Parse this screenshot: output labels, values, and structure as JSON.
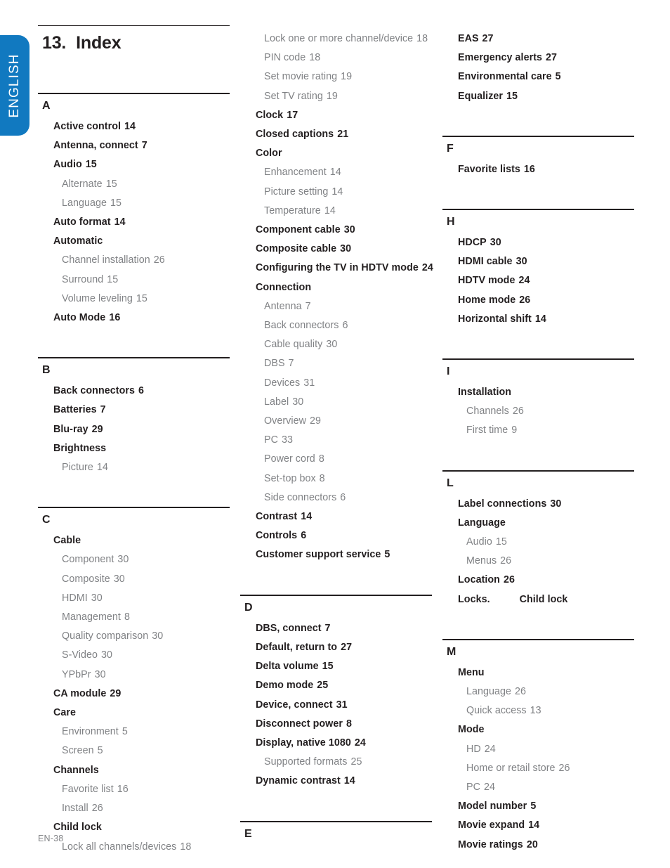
{
  "language_tab": {
    "label": "ENGLISH"
  },
  "title": {
    "number": "13.",
    "text": "Index"
  },
  "footer": {
    "page_label": "EN-38"
  },
  "colors": {
    "tab_blue": "#1179c0",
    "text_dark": "#231f20",
    "text_light": "#808285"
  },
  "columns": [
    {
      "id": "column-1",
      "has_title": true,
      "sections": [
        {
          "letter": "A",
          "entries": [
            {
              "level": 1,
              "text": "Active control",
              "page": "14"
            },
            {
              "level": 1,
              "text": "Antenna, connect",
              "page": "7"
            },
            {
              "level": 1,
              "text": "Audio",
              "page": "15"
            },
            {
              "level": 2,
              "text": "Alternate",
              "page": "15"
            },
            {
              "level": 2,
              "text": "Language",
              "page": "15"
            },
            {
              "level": 1,
              "text": "Auto format",
              "page": "14"
            },
            {
              "level": 1,
              "text": "Automatic",
              "page": ""
            },
            {
              "level": 2,
              "text": "Channel installation",
              "page": "26"
            },
            {
              "level": 2,
              "text": "Surround",
              "page": "15"
            },
            {
              "level": 2,
              "text": "Volume leveling",
              "page": "15"
            },
            {
              "level": 1,
              "text": "Auto Mode",
              "page": "16"
            }
          ]
        },
        {
          "letter": "B",
          "entries": [
            {
              "level": 1,
              "text": "Back connectors",
              "page": "6"
            },
            {
              "level": 1,
              "text": "Batteries",
              "page": "7"
            },
            {
              "level": 1,
              "text": "Blu-ray",
              "page": "29"
            },
            {
              "level": 1,
              "text": "Brightness",
              "page": ""
            },
            {
              "level": 2,
              "text": "Picture",
              "page": "14"
            }
          ]
        },
        {
          "letter": "C",
          "entries": [
            {
              "level": 1,
              "text": "Cable",
              "page": ""
            },
            {
              "level": 2,
              "text": "Component",
              "page": "30"
            },
            {
              "level": 2,
              "text": "Composite",
              "page": "30"
            },
            {
              "level": 2,
              "text": "HDMI",
              "page": "30"
            },
            {
              "level": 2,
              "text": "Management",
              "page": "8"
            },
            {
              "level": 2,
              "text": "Quality comparison",
              "page": "30"
            },
            {
              "level": 2,
              "text": "S-Video",
              "page": "30"
            },
            {
              "level": 2,
              "text": "YPbPr",
              "page": "30"
            },
            {
              "level": 1,
              "text": "CA module",
              "page": "29"
            },
            {
              "level": 1,
              "text": "Care",
              "page": ""
            },
            {
              "level": 2,
              "text": "Environment",
              "page": "5"
            },
            {
              "level": 2,
              "text": "Screen",
              "page": "5"
            },
            {
              "level": 1,
              "text": "Channels",
              "page": ""
            },
            {
              "level": 2,
              "text": "Favorite list",
              "page": "16"
            },
            {
              "level": 2,
              "text": "Install",
              "page": "26"
            },
            {
              "level": 1,
              "text": "Child lock",
              "page": ""
            },
            {
              "level": 2,
              "text": "Lock all channels/devices",
              "page": "18"
            }
          ]
        }
      ]
    },
    {
      "id": "column-2",
      "has_title": false,
      "sections": [
        {
          "letter": "",
          "continued": true,
          "entries": [
            {
              "level": 2,
              "text": "Lock one or more channel/device",
              "page": "18"
            },
            {
              "level": 2,
              "text": "PIN code",
              "page": "18"
            },
            {
              "level": 2,
              "text": "Set movie rating",
              "page": "19"
            },
            {
              "level": 2,
              "text": "Set TV rating",
              "page": "19"
            },
            {
              "level": 1,
              "text": "Clock",
              "page": "17"
            },
            {
              "level": 1,
              "text": "Closed captions",
              "page": "21"
            },
            {
              "level": 1,
              "text": "Color",
              "page": ""
            },
            {
              "level": 2,
              "text": "Enhancement",
              "page": "14"
            },
            {
              "level": 2,
              "text": "Picture setting",
              "page": "14"
            },
            {
              "level": 2,
              "text": "Temperature",
              "page": "14"
            },
            {
              "level": 1,
              "text": "Component cable",
              "page": "30"
            },
            {
              "level": 1,
              "text": "Composite cable",
              "page": "30"
            },
            {
              "level": 1,
              "text": "Configuring the TV in HDTV mode",
              "page": "24"
            },
            {
              "level": 1,
              "text": "Connection",
              "page": ""
            },
            {
              "level": 2,
              "text": "Antenna",
              "page": "7"
            },
            {
              "level": 2,
              "text": "Back connectors",
              "page": "6"
            },
            {
              "level": 2,
              "text": "Cable quality",
              "page": "30"
            },
            {
              "level": 2,
              "text": "DBS",
              "page": "7"
            },
            {
              "level": 2,
              "text": "Devices",
              "page": "31"
            },
            {
              "level": 2,
              "text": "Label",
              "page": "30"
            },
            {
              "level": 2,
              "text": "Overview",
              "page": "29"
            },
            {
              "level": 2,
              "text": "PC",
              "page": "33"
            },
            {
              "level": 2,
              "text": "Power cord",
              "page": "8"
            },
            {
              "level": 2,
              "text": "Set-top box",
              "page": "8"
            },
            {
              "level": 2,
              "text": "Side connectors",
              "page": "6"
            },
            {
              "level": 1,
              "text": "Contrast",
              "page": "14"
            },
            {
              "level": 1,
              "text": "Controls",
              "page": "6"
            },
            {
              "level": 1,
              "text": "Customer support service",
              "page": "5"
            }
          ]
        },
        {
          "letter": "D",
          "entries": [
            {
              "level": 1,
              "text": "DBS, connect",
              "page": "7"
            },
            {
              "level": 1,
              "text": "Default, return to",
              "page": "27"
            },
            {
              "level": 1,
              "text": "Delta volume",
              "page": "15"
            },
            {
              "level": 1,
              "text": "Demo mode",
              "page": "25"
            },
            {
              "level": 1,
              "text": "Device, connect",
              "page": "31"
            },
            {
              "level": 1,
              "text": "Disconnect power",
              "page": "8"
            },
            {
              "level": 1,
              "text": "Display, native 1080",
              "page": "24"
            },
            {
              "level": 2,
              "text": "Supported formats",
              "page": "25"
            },
            {
              "level": 1,
              "text": "Dynamic contrast",
              "page": "14"
            }
          ]
        },
        {
          "letter": "E",
          "entries": []
        }
      ]
    },
    {
      "id": "column-3",
      "has_title": false,
      "sections": [
        {
          "letter": "",
          "continued": true,
          "entries": [
            {
              "level": 1,
              "text": "EAS",
              "page": "27"
            },
            {
              "level": 1,
              "text": "Emergency alerts",
              "page": "27"
            },
            {
              "level": 1,
              "text": "Environmental care",
              "page": "5"
            },
            {
              "level": 1,
              "text": "Equalizer",
              "page": "15"
            }
          ]
        },
        {
          "letter": "F",
          "entries": [
            {
              "level": 1,
              "text": "Favorite lists",
              "page": "16"
            }
          ]
        },
        {
          "letter": "H",
          "entries": [
            {
              "level": 1,
              "text": "HDCP",
              "page": "30"
            },
            {
              "level": 1,
              "text": "HDMI cable",
              "page": "30"
            },
            {
              "level": 1,
              "text": "HDTV mode",
              "page": "24"
            },
            {
              "level": 1,
              "text": "Home mode",
              "page": "26"
            },
            {
              "level": 1,
              "text": "Horizontal shift",
              "page": "14"
            }
          ]
        },
        {
          "letter": "I",
          "entries": [
            {
              "level": 1,
              "text": "Installation",
              "page": ""
            },
            {
              "level": 2,
              "text": "Channels",
              "page": "26"
            },
            {
              "level": 2,
              "text": "First time",
              "page": "9"
            }
          ]
        },
        {
          "letter": "L",
          "entries": [
            {
              "level": 1,
              "text": "Label connections",
              "page": "30"
            },
            {
              "level": 1,
              "text": "Language",
              "page": ""
            },
            {
              "level": 2,
              "text": "Audio",
              "page": "15"
            },
            {
              "level": 2,
              "text": "Menus",
              "page": "26"
            },
            {
              "level": 1,
              "text": "Location",
              "page": "26"
            },
            {
              "level": 1,
              "text": "Locks.",
              "page": "",
              "reference": "Child lock"
            }
          ]
        },
        {
          "letter": "M",
          "entries": [
            {
              "level": 1,
              "text": "Menu",
              "page": ""
            },
            {
              "level": 2,
              "text": "Language",
              "page": "26"
            },
            {
              "level": 2,
              "text": "Quick access",
              "page": "13"
            },
            {
              "level": 1,
              "text": "Mode",
              "page": ""
            },
            {
              "level": 2,
              "text": "HD",
              "page": "24"
            },
            {
              "level": 2,
              "text": "Home or retail store",
              "page": "26"
            },
            {
              "level": 2,
              "text": "PC",
              "page": "24"
            },
            {
              "level": 1,
              "text": "Model number",
              "page": "5"
            },
            {
              "level": 1,
              "text": "Movie expand",
              "page": "14"
            },
            {
              "level": 1,
              "text": "Movie ratings",
              "page": "20"
            }
          ]
        }
      ]
    }
  ]
}
